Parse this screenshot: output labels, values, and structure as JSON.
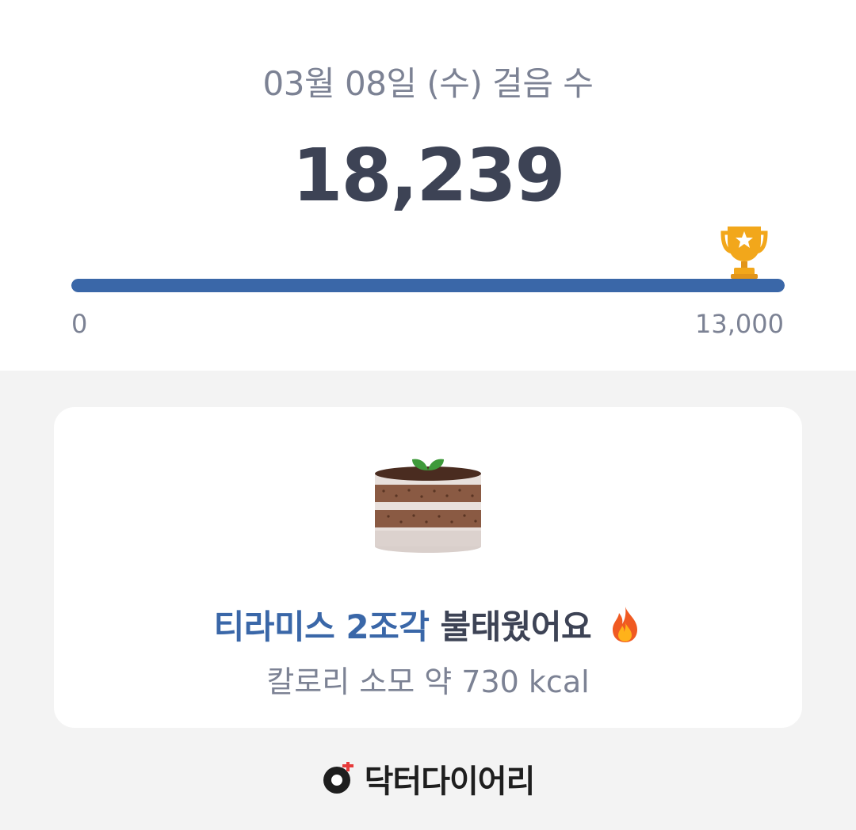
{
  "header": {
    "title": "03월 08일 (수) 걸음 수",
    "step_count": "18,239",
    "icon": "trophy-icon"
  },
  "progress": {
    "fraction": 1.0,
    "min_label": "0",
    "max_label": "13,000",
    "fill_color": "#3a67a8"
  },
  "card": {
    "image": "tiramisu-cake-icon",
    "food_highlight": "티라미스 2조각",
    "burned_suffix": "불태웠어요",
    "emoji": "fire-icon",
    "calorie_text": "칼로리 소모 약 730 kcal"
  },
  "brand": {
    "logo": "doctor-diary-logo-icon",
    "name": "닥터다이어리"
  }
}
